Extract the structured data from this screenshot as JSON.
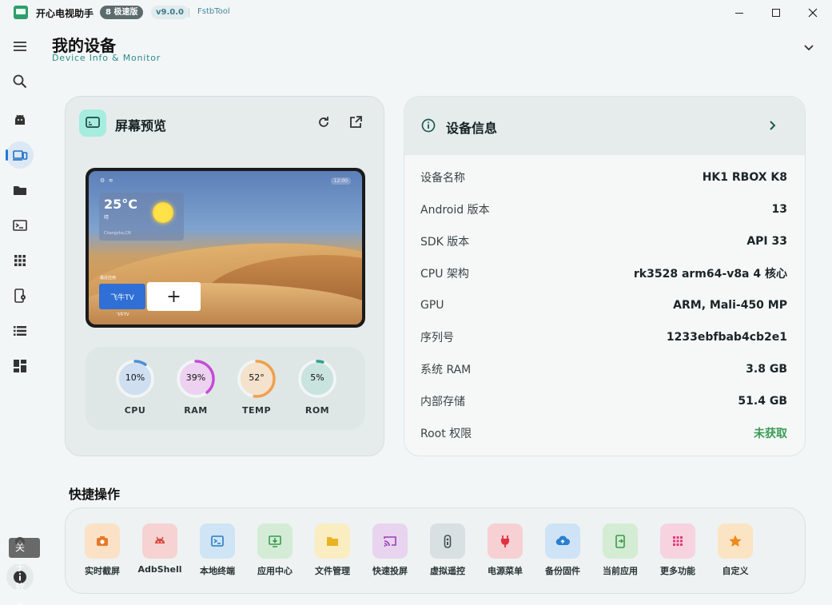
{
  "titlebar": {
    "app_name": "开心电视助手",
    "edition": "8 极速版",
    "version": "v9.0.0",
    "subtitle": "FstbTool"
  },
  "sidebar": {
    "items": [
      {
        "icon": "menu-icon"
      },
      {
        "icon": "search-icon"
      },
      {
        "icon": "android-icon"
      },
      {
        "icon": "devices-icon",
        "active": true
      },
      {
        "icon": "folder-icon"
      },
      {
        "icon": "terminal-icon"
      },
      {
        "icon": "apps-grid-icon"
      },
      {
        "icon": "app-settings-icon"
      },
      {
        "icon": "list-icon"
      },
      {
        "icon": "dashboard-icon"
      }
    ],
    "bottom": [
      {
        "icon": "settings-icon"
      },
      {
        "icon": "info-icon"
      }
    ],
    "tooltip": "关于软件"
  },
  "header": {
    "title": "我的设备",
    "subtitle": "Device Info & Monitor"
  },
  "preview": {
    "title": "屏幕预览",
    "screen": {
      "weather_temp": "25°C",
      "weather_desc": "晴",
      "weather_location": "Changsha,CN",
      "clock": "12:00",
      "recent_label": "最近应用",
      "app_tile": "飞牛TV",
      "app_tile_caption": "飞牛TV",
      "add_tile": "+"
    },
    "gauges": [
      {
        "label": "CPU",
        "value": "10%",
        "percent": 10,
        "color": "#4a90d9",
        "bg": "#cfdef0"
      },
      {
        "label": "RAM",
        "value": "39%",
        "percent": 39,
        "color": "#c54ad6",
        "bg": "#ecd2f0"
      },
      {
        "label": "TEMP",
        "value": "52°",
        "percent": 52,
        "color": "#f0a04a",
        "bg": "#f4e2cc"
      },
      {
        "label": "ROM",
        "value": "5%",
        "percent": 5,
        "color": "#2aa090",
        "bg": "#c9e3de"
      }
    ]
  },
  "device_info": {
    "title": "设备信息",
    "rows": [
      {
        "label": "设备名称",
        "value": "HK1 RBOX K8"
      },
      {
        "label": "Android 版本",
        "value": "13"
      },
      {
        "label": "SDK 版本",
        "value": "API 33"
      },
      {
        "label": "CPU 架构",
        "value": "rk3528 arm64-v8a 4 核心"
      },
      {
        "label": "GPU",
        "value": "ARM, Mali-450 MP"
      },
      {
        "label": "序列号",
        "value": "1233ebfbab4cb2e1"
      },
      {
        "label": "系统 RAM",
        "value": "3.8 GB"
      },
      {
        "label": "内部存储",
        "value": "51.4 GB"
      },
      {
        "label": "Root 权限",
        "value": "未获取"
      }
    ]
  },
  "quick_actions": {
    "title": "快捷操作",
    "items": [
      {
        "label": "实时截屏",
        "icon": "camera-icon",
        "bg": "#fbe1c6",
        "fg": "#e8782a"
      },
      {
        "label": "AdbShell",
        "icon": "android-icon",
        "bg": "#f7d2d2",
        "fg": "#d9473f"
      },
      {
        "label": "本地终端",
        "icon": "terminal-icon",
        "bg": "#cfe4f4",
        "fg": "#2a7dc4"
      },
      {
        "label": "应用中心",
        "icon": "install-icon",
        "bg": "#d4ecd6",
        "fg": "#3c9a4e"
      },
      {
        "label": "文件管理",
        "icon": "folder-icon",
        "bg": "#faedc2",
        "fg": "#e9b321"
      },
      {
        "label": "快速投屏",
        "icon": "cast-icon",
        "bg": "#e8d4ef",
        "fg": "#9a3fb4"
      },
      {
        "label": "虚拟遥控",
        "icon": "remote-icon",
        "bg": "#d9e0e2",
        "fg": "#3f5258"
      },
      {
        "label": "电源菜单",
        "icon": "power-plug-icon",
        "bg": "#f7d0d4",
        "fg": "#e0313f"
      },
      {
        "label": "备份固件",
        "icon": "cloud-upload-icon",
        "bg": "#cfe3f6",
        "fg": "#2a7fd0"
      },
      {
        "label": "当前应用",
        "icon": "current-app-icon",
        "bg": "#d4ecd4",
        "fg": "#3a9a4a"
      },
      {
        "label": "更多功能",
        "icon": "more-grid-icon",
        "bg": "#f7d3e0",
        "fg": "#e03c78"
      },
      {
        "label": "自定义",
        "icon": "star-icon",
        "bg": "#fbe4c4",
        "fg": "#f0891c"
      }
    ]
  }
}
